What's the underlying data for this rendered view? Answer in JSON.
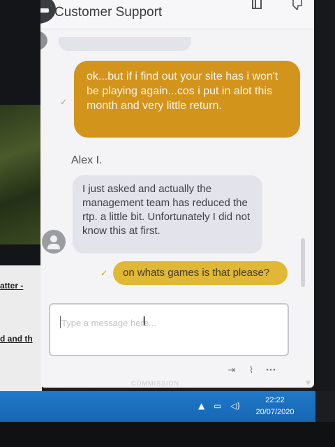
{
  "window": {
    "title": "Customer Support"
  },
  "background_page": {
    "link_1": "atter -",
    "link_2": "d and th"
  },
  "chat": {
    "messages": [
      {
        "id": "outgoing-1",
        "sender": "user",
        "text": "ok...but if i find out your site has i won't be playing again...cos i put in alot this month and very little return.",
        "status": "✓",
        "color": "#d3941c"
      },
      {
        "id": "incoming-1",
        "sender": "agent",
        "agent_name": "Alex I.",
        "text": "I just asked and actually the management team has reduced the rtp. a little bit. Unfortunately I did not know this at first."
      },
      {
        "id": "outgoing-2",
        "sender": "user",
        "text": "on whats games is that please?",
        "status": "✓",
        "color": "#e1b835"
      }
    ]
  },
  "composer": {
    "placeholder": "Type a message here..."
  },
  "toolbar": {
    "icons": [
      "exit-icon",
      "attachment-icon",
      "more-icon"
    ]
  },
  "ghost_text": "COMMISSION",
  "taskbar": {
    "time": "22:22",
    "date": "20/07/2020",
    "icons": [
      "chevron-up-icon",
      "network-icon",
      "speaker-icon"
    ]
  },
  "colors": {
    "accent_orange": "#d3941c",
    "accent_yellow": "#e1b835",
    "taskbar_blue": "#1f79c8",
    "agent_bubble": "#e3e3ec"
  }
}
